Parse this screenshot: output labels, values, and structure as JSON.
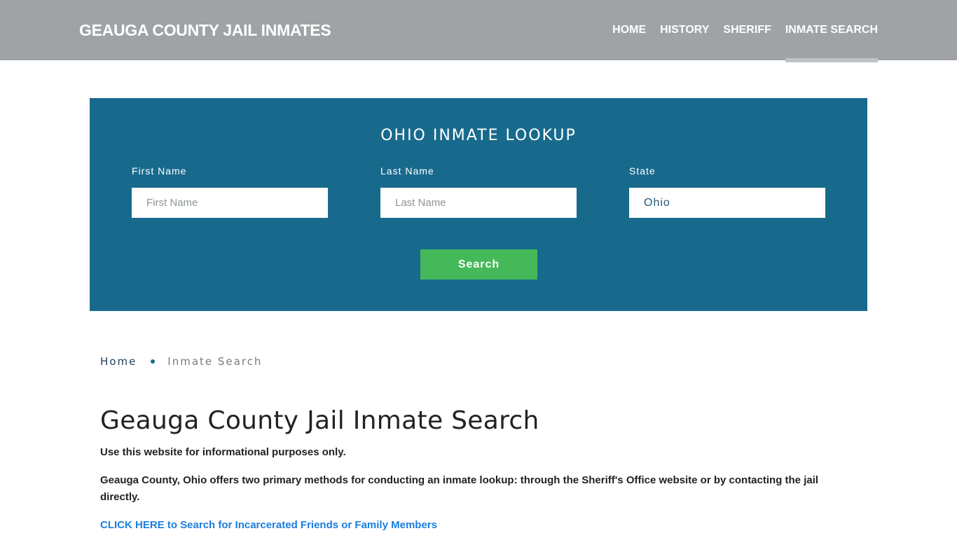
{
  "header": {
    "brand": "GEAUGA COUNTY JAIL INMATES",
    "nav": [
      {
        "label": "HOME",
        "active": false
      },
      {
        "label": "HISTORY",
        "active": false
      },
      {
        "label": "SHERIFF",
        "active": false
      },
      {
        "label": "INMATE SEARCH",
        "active": true
      }
    ]
  },
  "lookup": {
    "title": "OHIO INMATE LOOKUP",
    "first_name": {
      "label": "First Name",
      "placeholder": "First Name",
      "value": ""
    },
    "last_name": {
      "label": "Last Name",
      "placeholder": "Last Name",
      "value": ""
    },
    "state": {
      "label": "State",
      "value": "Ohio"
    },
    "search_label": "Search"
  },
  "breadcrumb": {
    "home": "Home",
    "current": "Inmate Search"
  },
  "content": {
    "title": "Geauga County Jail Inmate Search",
    "paragraph1": "Use this website for informational purposes only.",
    "paragraph2": "Geauga County, Ohio offers two primary methods for conducting an inmate lookup: through the Sheriff's Office website or by contacting the jail directly.",
    "cta_link": "CLICK HERE to Search for Incarcerated Friends or Family Members"
  },
  "colors": {
    "header_bg": "#9fa3a6",
    "lookup_bg": "#186a8d",
    "search_button": "#45b95a",
    "link": "#1a7de0"
  }
}
